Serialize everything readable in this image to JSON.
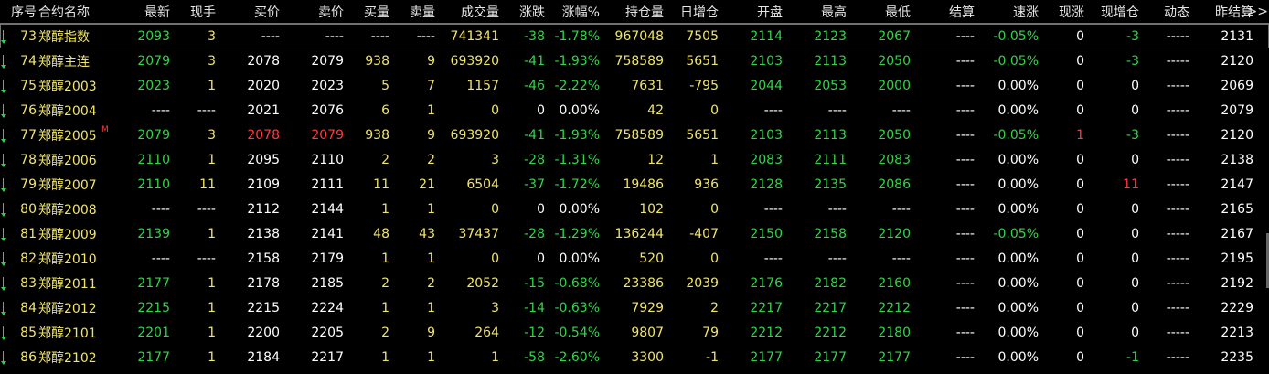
{
  "columns": [
    "序号",
    "合约名称",
    "最新",
    "现手",
    "买价",
    "卖价",
    "买量",
    "卖量",
    "成交量",
    "涨跌",
    "涨幅%",
    "持仓量",
    "日增仓",
    "开盘",
    "最高",
    "最低",
    "结算",
    "速涨",
    "现涨",
    "现增仓",
    "动态",
    "昨结算"
  ],
  "more_indicator": ">>",
  "rows": [
    [
      "73",
      "郑醇指数",
      "2093",
      "3",
      "----",
      "----",
      "----",
      "----",
      "741341",
      "-38",
      "-1.78%",
      "967048",
      "7505",
      "2114",
      "2123",
      "2067",
      "----",
      "-0.05%",
      "0",
      "-3",
      "-----",
      "2131"
    ],
    [
      "74",
      "郑醇主连",
      "2079",
      "3",
      "2078",
      "2079",
      "938",
      "9",
      "693920",
      "-41",
      "-1.93%",
      "758589",
      "5651",
      "2103",
      "2113",
      "2050",
      "----",
      "-0.05%",
      "0",
      "-3",
      "-----",
      "2120"
    ],
    [
      "75",
      "郑醇2003",
      "2023",
      "1",
      "2020",
      "2023",
      "5",
      "7",
      "1157",
      "-46",
      "-2.22%",
      "7631",
      "-795",
      "2044",
      "2053",
      "2000",
      "----",
      "0.00%",
      "0",
      "0",
      "-----",
      "2069"
    ],
    [
      "76",
      "郑醇2004",
      "----",
      "----",
      "2021",
      "2076",
      "6",
      "1",
      "0",
      "0",
      "0.00%",
      "42",
      "0",
      "----",
      "----",
      "----",
      "----",
      "0.00%",
      "0",
      "0",
      "-----",
      "2079"
    ],
    [
      "77",
      "郑醇2005",
      "2079",
      "3",
      "2078",
      "2079",
      "938",
      "9",
      "693920",
      "-41",
      "-1.93%",
      "758589",
      "5651",
      "2103",
      "2113",
      "2050",
      "----",
      "-0.05%",
      "1",
      "-3",
      "-----",
      "2120"
    ],
    [
      "78",
      "郑醇2006",
      "2110",
      "1",
      "2095",
      "2110",
      "2",
      "2",
      "3",
      "-28",
      "-1.31%",
      "12",
      "1",
      "2083",
      "2111",
      "2083",
      "----",
      "0.00%",
      "0",
      "0",
      "-----",
      "2138"
    ],
    [
      "79",
      "郑醇2007",
      "2110",
      "11",
      "2109",
      "2111",
      "11",
      "21",
      "6504",
      "-37",
      "-1.72%",
      "19486",
      "936",
      "2128",
      "2135",
      "2086",
      "----",
      "0.00%",
      "0",
      "11",
      "-----",
      "2147"
    ],
    [
      "80",
      "郑醇2008",
      "----",
      "----",
      "2112",
      "2144",
      "1",
      "1",
      "0",
      "0",
      "0.00%",
      "102",
      "0",
      "----",
      "----",
      "----",
      "----",
      "0.00%",
      "0",
      "0",
      "-----",
      "2165"
    ],
    [
      "81",
      "郑醇2009",
      "2139",
      "1",
      "2138",
      "2141",
      "48",
      "43",
      "37437",
      "-28",
      "-1.29%",
      "136244",
      "-407",
      "2150",
      "2158",
      "2120",
      "----",
      "-0.05%",
      "0",
      "0",
      "-----",
      "2167"
    ],
    [
      "82",
      "郑醇2010",
      "----",
      "----",
      "2158",
      "2179",
      "1",
      "1",
      "0",
      "0",
      "0.00%",
      "520",
      "0",
      "----",
      "----",
      "----",
      "----",
      "0.00%",
      "0",
      "0",
      "-----",
      "2195"
    ],
    [
      "83",
      "郑醇2011",
      "2177",
      "1",
      "2178",
      "2185",
      "2",
      "2",
      "2052",
      "-15",
      "-0.68%",
      "23386",
      "2039",
      "2176",
      "2182",
      "2160",
      "----",
      "0.00%",
      "0",
      "0",
      "-----",
      "2192"
    ],
    [
      "84",
      "郑醇2012",
      "2215",
      "1",
      "2215",
      "2224",
      "1",
      "1",
      "3",
      "-14",
      "-0.63%",
      "7929",
      "2",
      "2217",
      "2217",
      "2212",
      "----",
      "0.00%",
      "0",
      "0",
      "-----",
      "2229"
    ],
    [
      "85",
      "郑醇2101",
      "2201",
      "1",
      "2200",
      "2205",
      "2",
      "9",
      "264",
      "-12",
      "-0.54%",
      "9807",
      "79",
      "2212",
      "2212",
      "2180",
      "----",
      "0.00%",
      "0",
      "0",
      "-----",
      "2213"
    ],
    [
      "86",
      "郑醇2102",
      "2177",
      "1",
      "2184",
      "2217",
      "1",
      "1",
      "1",
      "-58",
      "-2.60%",
      "3300",
      "-1",
      "2177",
      "2177",
      "2177",
      "----",
      "0.00%",
      "0",
      "-1",
      "-----",
      "2235"
    ]
  ],
  "main_contract_badge": "M",
  "colors": {
    "green": "#34d34a",
    "yellow": "#f0e56a",
    "white": "#ffffff",
    "red": "#ff3b3b",
    "header_rule": "#c85a00"
  }
}
